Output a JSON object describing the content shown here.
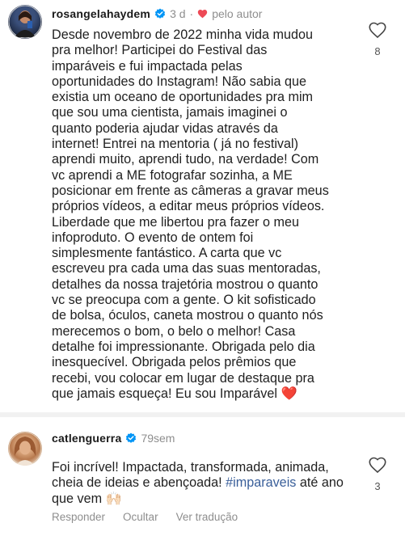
{
  "comments": [
    {
      "username": "rosangelahaydem",
      "time": "3 d",
      "dot": "·",
      "liked_by_author": "pelo autor",
      "text": "Desde novembro de 2022 minha vida mudou\npra melhor! Participei do Festival das\nimparáveis e fui impactada pelas\noportunidades do Instagram! Não sabia que\nexistia um oceano de oportunidades pra mim\nque sou uma cientista, jamais imaginei o\nquanto poderia ajudar vidas através da\ninternet! Entrei na mentoria ( já no festival)\naprendi muito, aprendi tudo, na verdade! Com\nvc aprendi a ME fotografar sozinha, a ME\nposicionar em frente as câmeras a gravar meus\npróprios vídeos, a editar meus próprios vídeos.\nLiberdade que me libertou pra fazer o meu\ninfoproduto. O evento de ontem foi\nsimplesmente fantástico. A carta que vc\nescreveu pra cada uma das suas mentoradas,\ndetalhes da nossa trajetória mostrou o quanto\nvc se preocupa com a gente. O kit sofisticado\nde bolsa, óculos, caneta mostrou o quanto nós\nmerecemos o bom, o belo o melhor! Casa\ndetalhe foi impressionante. Obrigada pelo dia\ninesquecível. Obrigada pelos prêmios que\nrecebi, vou colocar em lugar de destaque pra\nque jamais esqueça! Eu sou Imparável ❤️",
      "likes": "8"
    },
    {
      "username": "catlenguerra",
      "time": "79sem",
      "text_before": "Foi incrível! Impactada, transformada, animada,\ncheia de ideias e abençoada! ",
      "hashtag": "#imparaveis",
      "text_after": " até ano\nque vem 🙌🏻",
      "likes": "3",
      "actions": {
        "reply": "Responder",
        "hide": "Ocultar",
        "translate": "Ver tradução"
      }
    }
  ],
  "colors": {
    "verified": "#0095f6",
    "heart_red": "#ed4956",
    "meta_gray": "#8e8e8e",
    "hashtag": "#3a5f9a"
  },
  "icons": [
    "verified-badge-icon",
    "heart-filled-icon",
    "heart-outline-icon"
  ]
}
